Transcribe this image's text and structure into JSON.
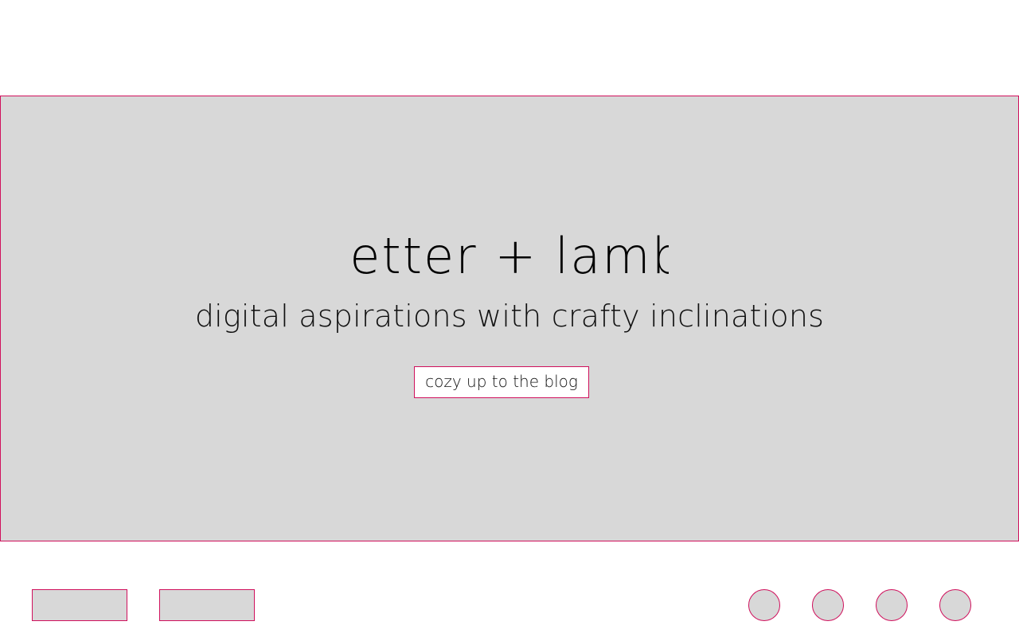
{
  "colors": {
    "accent": "#d0105c",
    "placeholder": "#d8d8d8",
    "background": "#ffffff",
    "text": "#111111"
  },
  "hero": {
    "title": "letter + lamb",
    "subtitle": "digital aspirations with crafty inclinations",
    "cta_label": "cozy up to the blog"
  },
  "footer": {
    "nav_buttons": [
      "",
      ""
    ],
    "social_icons": [
      "",
      "",
      "",
      ""
    ]
  }
}
